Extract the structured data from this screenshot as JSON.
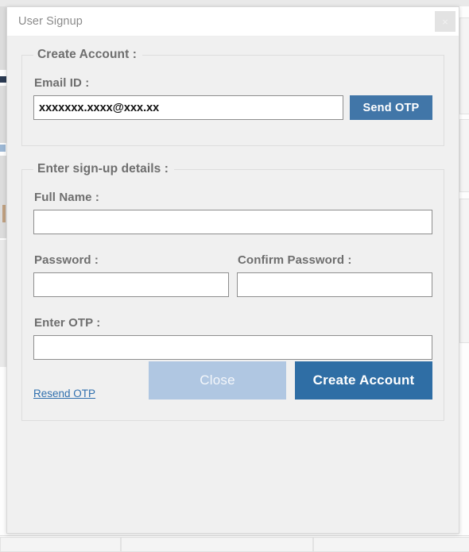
{
  "window": {
    "title": "User Signup",
    "close_icon": "close-icon",
    "close_glyph": "×"
  },
  "create_account_group": {
    "legend": "Create Account :",
    "email": {
      "label": "Email ID :",
      "value": "xxxxxxx.xxxx@xxx.xx",
      "placeholder": ""
    },
    "send_otp_label": "Send OTP"
  },
  "signup_details_group": {
    "legend": "Enter sign-up details :",
    "full_name": {
      "label": "Full Name :",
      "value": "",
      "placeholder": ""
    },
    "password": {
      "label": "Password :",
      "value": "",
      "placeholder": ""
    },
    "confirm_password": {
      "label": "Confirm Password :",
      "value": "",
      "placeholder": ""
    },
    "otp": {
      "label": "Enter OTP :",
      "value": "",
      "placeholder": ""
    },
    "resend_otp_label": "Resend OTP",
    "close_label": "Close",
    "create_account_label": "Create Account"
  },
  "colors": {
    "send_otp_blue": "#4176a8",
    "create_account_blue": "#2f6ea5",
    "close_blue": "#b0c7e2",
    "link_blue": "#2f6fae",
    "label_gray": "#6e6e6e",
    "dialog_bg": "#f0f0f0",
    "title_bar_bg": "#ffffff"
  }
}
